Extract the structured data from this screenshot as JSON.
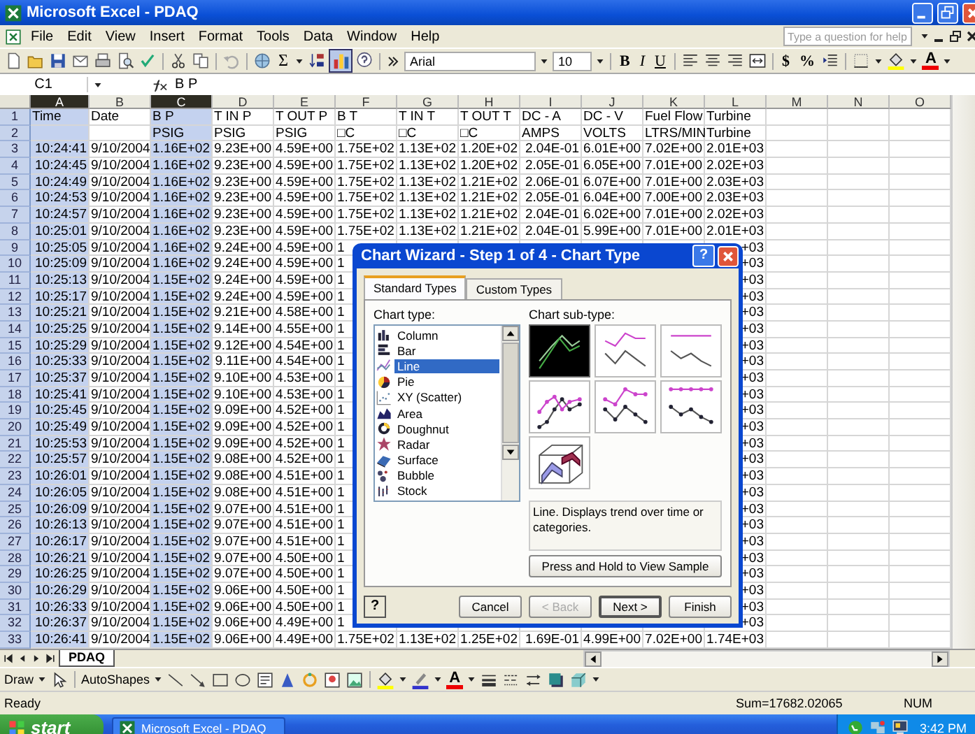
{
  "window": {
    "title": "Microsoft Excel - PDAQ"
  },
  "menu": [
    "File",
    "Edit",
    "View",
    "Insert",
    "Format",
    "Tools",
    "Data",
    "Window",
    "Help"
  ],
  "help_search": {
    "placeholder": "Type a question for help"
  },
  "toolbar": {
    "autosum": "Σ",
    "chart_wizard_pressed": true,
    "font": "Arial",
    "size": "10",
    "styles": [
      "B",
      "I",
      "U"
    ],
    "number_formats": [
      "$",
      "%"
    ],
    "font_color": "A"
  },
  "formula_bar": {
    "cell": "C1",
    "value": "B P"
  },
  "sheet": {
    "columns": [
      {
        "label": "A",
        "selected": true
      },
      {
        "label": "B",
        "selected": false
      },
      {
        "label": "C",
        "selected": true
      },
      {
        "label": "D",
        "selected": false
      },
      {
        "label": "E",
        "selected": false
      },
      {
        "label": "F",
        "selected": false
      },
      {
        "label": "G",
        "selected": false
      },
      {
        "label": "H",
        "selected": false
      },
      {
        "label": "I",
        "selected": false
      },
      {
        "label": "J",
        "selected": false
      },
      {
        "label": "K",
        "selected": false
      },
      {
        "label": "L",
        "selected": false
      },
      {
        "label": "M",
        "selected": false
      },
      {
        "label": "N",
        "selected": false
      },
      {
        "label": "O",
        "selected": false
      }
    ],
    "rows": [
      {
        "header": "1",
        "cells": [
          "Time",
          "Date",
          "B P",
          "T IN P",
          "T OUT P",
          "B T",
          "T IN T",
          "T OUT T",
          "DC - A",
          "DC - V",
          "Fuel Flow",
          "Turbine"
        ]
      },
      {
        "header": "2",
        "cells": [
          null,
          null,
          "PSIG",
          "PSIG",
          "PSIG",
          "□C",
          "□C",
          "□C",
          "AMPS",
          "VOLTS",
          "LTRS/MIN",
          "Turbine"
        ]
      },
      {
        "header": "3",
        "cells": [
          "10:24:41",
          "9/10/2004",
          "1.16E+02",
          "9.23E+00",
          "4.59E+00",
          "1.75E+02",
          "1.13E+02",
          "1.20E+02",
          "2.04E-01",
          "6.01E+00",
          "7.02E+00",
          "2.01E+03"
        ]
      },
      {
        "header": "4",
        "cells": [
          "10:24:45",
          "9/10/2004",
          "1.16E+02",
          "9.23E+00",
          "4.59E+00",
          "1.75E+02",
          "1.13E+02",
          "1.20E+02",
          "2.05E-01",
          "6.05E+00",
          "7.01E+00",
          "2.02E+03"
        ]
      },
      {
        "header": "5",
        "cells": [
          "10:24:49",
          "9/10/2004",
          "1.16E+02",
          "9.23E+00",
          "4.59E+00",
          "1.75E+02",
          "1.13E+02",
          "1.21E+02",
          "2.06E-01",
          "6.07E+00",
          "7.01E+00",
          "2.03E+03"
        ]
      },
      {
        "header": "6",
        "cells": [
          "10:24:53",
          "9/10/2004",
          "1.16E+02",
          "9.23E+00",
          "4.59E+00",
          "1.75E+02",
          "1.13E+02",
          "1.21E+02",
          "2.05E-01",
          "6.04E+00",
          "7.00E+00",
          "2.03E+03"
        ]
      },
      {
        "header": "7",
        "cells": [
          "10:24:57",
          "9/10/2004",
          "1.16E+02",
          "9.23E+00",
          "4.59E+00",
          "1.75E+02",
          "1.13E+02",
          "1.21E+02",
          "2.04E-01",
          "6.02E+00",
          "7.01E+00",
          "2.02E+03"
        ]
      },
      {
        "header": "8",
        "cells": [
          "10:25:01",
          "9/10/2004",
          "1.16E+02",
          "9.23E+00",
          "4.59E+00",
          "1.75E+02",
          "1.13E+02",
          "1.21E+02",
          "2.04E-01",
          "5.99E+00",
          "7.01E+00",
          "2.01E+03"
        ]
      },
      {
        "header": "9",
        "cells": [
          "10:25:05",
          "9/10/2004",
          "1.16E+02",
          "9.24E+00",
          "4.59E+00",
          "1",
          null,
          null,
          null,
          null,
          null,
          "+03"
        ]
      },
      {
        "header": "10",
        "cells": [
          "10:25:09",
          "9/10/2004",
          "1.16E+02",
          "9.24E+00",
          "4.59E+00",
          "1",
          null,
          null,
          null,
          null,
          null,
          "+03"
        ]
      },
      {
        "header": "11",
        "cells": [
          "10:25:13",
          "9/10/2004",
          "1.15E+02",
          "9.24E+00",
          "4.59E+00",
          "1",
          null,
          null,
          null,
          null,
          null,
          "+03"
        ]
      },
      {
        "header": "12",
        "cells": [
          "10:25:17",
          "9/10/2004",
          "1.15E+02",
          "9.24E+00",
          "4.59E+00",
          "1",
          null,
          null,
          null,
          null,
          null,
          "+03"
        ]
      },
      {
        "header": "13",
        "cells": [
          "10:25:21",
          "9/10/2004",
          "1.15E+02",
          "9.21E+00",
          "4.58E+00",
          "1",
          null,
          null,
          null,
          null,
          null,
          "+03"
        ]
      },
      {
        "header": "14",
        "cells": [
          "10:25:25",
          "9/10/2004",
          "1.15E+02",
          "9.14E+00",
          "4.55E+00",
          "1",
          null,
          null,
          null,
          null,
          null,
          "+03"
        ]
      },
      {
        "header": "15",
        "cells": [
          "10:25:29",
          "9/10/2004",
          "1.15E+02",
          "9.12E+00",
          "4.54E+00",
          "1",
          null,
          null,
          null,
          null,
          null,
          "+03"
        ]
      },
      {
        "header": "16",
        "cells": [
          "10:25:33",
          "9/10/2004",
          "1.15E+02",
          "9.11E+00",
          "4.54E+00",
          "1",
          null,
          null,
          null,
          null,
          null,
          "+03"
        ]
      },
      {
        "header": "17",
        "cells": [
          "10:25:37",
          "9/10/2004",
          "1.15E+02",
          "9.10E+00",
          "4.53E+00",
          "1",
          null,
          null,
          null,
          null,
          null,
          "+03"
        ]
      },
      {
        "header": "18",
        "cells": [
          "10:25:41",
          "9/10/2004",
          "1.15E+02",
          "9.10E+00",
          "4.53E+00",
          "1",
          null,
          null,
          null,
          null,
          null,
          "+03"
        ]
      },
      {
        "header": "19",
        "cells": [
          "10:25:45",
          "9/10/2004",
          "1.15E+02",
          "9.09E+00",
          "4.52E+00",
          "1",
          null,
          null,
          null,
          null,
          null,
          "+03"
        ]
      },
      {
        "header": "20",
        "cells": [
          "10:25:49",
          "9/10/2004",
          "1.15E+02",
          "9.09E+00",
          "4.52E+00",
          "1",
          null,
          null,
          null,
          null,
          null,
          "+03"
        ]
      },
      {
        "header": "21",
        "cells": [
          "10:25:53",
          "9/10/2004",
          "1.15E+02",
          "9.09E+00",
          "4.52E+00",
          "1",
          null,
          null,
          null,
          null,
          null,
          "+03"
        ]
      },
      {
        "header": "22",
        "cells": [
          "10:25:57",
          "9/10/2004",
          "1.15E+02",
          "9.08E+00",
          "4.52E+00",
          "1",
          null,
          null,
          null,
          null,
          null,
          "+03"
        ]
      },
      {
        "header": "23",
        "cells": [
          "10:26:01",
          "9/10/2004",
          "1.15E+02",
          "9.08E+00",
          "4.51E+00",
          "1",
          null,
          null,
          null,
          null,
          null,
          "+03"
        ]
      },
      {
        "header": "24",
        "cells": [
          "10:26:05",
          "9/10/2004",
          "1.15E+02",
          "9.08E+00",
          "4.51E+00",
          "1",
          null,
          null,
          null,
          null,
          null,
          "+03"
        ]
      },
      {
        "header": "25",
        "cells": [
          "10:26:09",
          "9/10/2004",
          "1.15E+02",
          "9.07E+00",
          "4.51E+00",
          "1",
          null,
          null,
          null,
          null,
          null,
          "+03"
        ]
      },
      {
        "header": "26",
        "cells": [
          "10:26:13",
          "9/10/2004",
          "1.15E+02",
          "9.07E+00",
          "4.51E+00",
          "1",
          null,
          null,
          null,
          null,
          null,
          "+03"
        ]
      },
      {
        "header": "27",
        "cells": [
          "10:26:17",
          "9/10/2004",
          "1.15E+02",
          "9.07E+00",
          "4.51E+00",
          "1",
          null,
          null,
          null,
          null,
          null,
          "+03"
        ]
      },
      {
        "header": "28",
        "cells": [
          "10:26:21",
          "9/10/2004",
          "1.15E+02",
          "9.07E+00",
          "4.50E+00",
          "1",
          null,
          null,
          null,
          null,
          null,
          "+03"
        ]
      },
      {
        "header": "29",
        "cells": [
          "10:26:25",
          "9/10/2004",
          "1.15E+02",
          "9.07E+00",
          "4.50E+00",
          "1",
          null,
          null,
          null,
          null,
          null,
          "+03"
        ]
      },
      {
        "header": "30",
        "cells": [
          "10:26:29",
          "9/10/2004",
          "1.15E+02",
          "9.06E+00",
          "4.50E+00",
          "1",
          null,
          null,
          null,
          null,
          null,
          "+03"
        ]
      },
      {
        "header": "31",
        "cells": [
          "10:26:33",
          "9/10/2004",
          "1.15E+02",
          "9.06E+00",
          "4.50E+00",
          "1",
          null,
          null,
          null,
          null,
          null,
          "+03"
        ]
      },
      {
        "header": "32",
        "cells": [
          "10:26:37",
          "9/10/2004",
          "1.15E+02",
          "9.06E+00",
          "4.49E+00",
          "1",
          null,
          null,
          null,
          null,
          null,
          "+03"
        ]
      },
      {
        "header": "33",
        "cells": [
          "10:26:41",
          "9/10/2004",
          "1.15E+02",
          "9.06E+00",
          "4.49E+00",
          "1.75E+02",
          "1.13E+02",
          "1.25E+02",
          "1.69E-01",
          "4.99E+00",
          "7.02E+00",
          "1.74E+03"
        ]
      }
    ]
  },
  "dialog": {
    "title": "Chart Wizard - Step 1 of 4 - Chart Type",
    "title_help": "?",
    "tabs": [
      {
        "label": "Standard Types",
        "selected": true
      },
      {
        "label": "Custom Types",
        "selected": false
      }
    ],
    "chart_type_label": "Chart type:",
    "chart_types": [
      {
        "label": "Column",
        "selected": false
      },
      {
        "label": "Bar",
        "selected": false
      },
      {
        "label": "Line",
        "selected": true
      },
      {
        "label": "Pie",
        "selected": false
      },
      {
        "label": "XY (Scatter)",
        "selected": false
      },
      {
        "label": "Area",
        "selected": false
      },
      {
        "label": "Doughnut",
        "selected": false
      },
      {
        "label": "Radar",
        "selected": false
      },
      {
        "label": "Surface",
        "selected": false
      },
      {
        "label": "Bubble",
        "selected": false
      },
      {
        "label": "Stock",
        "selected": false
      }
    ],
    "subtype_label": "Chart sub-type:",
    "subtypes": [
      {
        "selected": true
      },
      {
        "selected": false
      },
      {
        "selected": false
      },
      {
        "selected": false
      },
      {
        "selected": false
      },
      {
        "selected": false
      },
      {
        "selected": false
      }
    ],
    "description": "Line. Displays trend over time or categories.",
    "sample_button": "Press and Hold to View Sample",
    "footer_help": "?",
    "buttons": [
      {
        "label": "Cancel",
        "disabled": false,
        "default": false
      },
      {
        "label": "< Back",
        "disabled": true,
        "default": false
      },
      {
        "label": "Next >",
        "disabled": false,
        "default": true
      },
      {
        "label": "Finish",
        "disabled": false,
        "default": false
      }
    ]
  },
  "sheet_tabs": [
    {
      "label": "PDAQ",
      "selected": true
    }
  ],
  "draw_toolbar": {
    "draw": "Draw",
    "autoshapes": "AutoShapes",
    "font_color": "A"
  },
  "status_bar": {
    "status": "Ready",
    "sum": "Sum=17682.02065",
    "mode": "NUM"
  },
  "taskbar": {
    "start": "start",
    "tasks": [
      "Microsoft Excel - PDAQ"
    ],
    "clock": "3:42 PM"
  }
}
